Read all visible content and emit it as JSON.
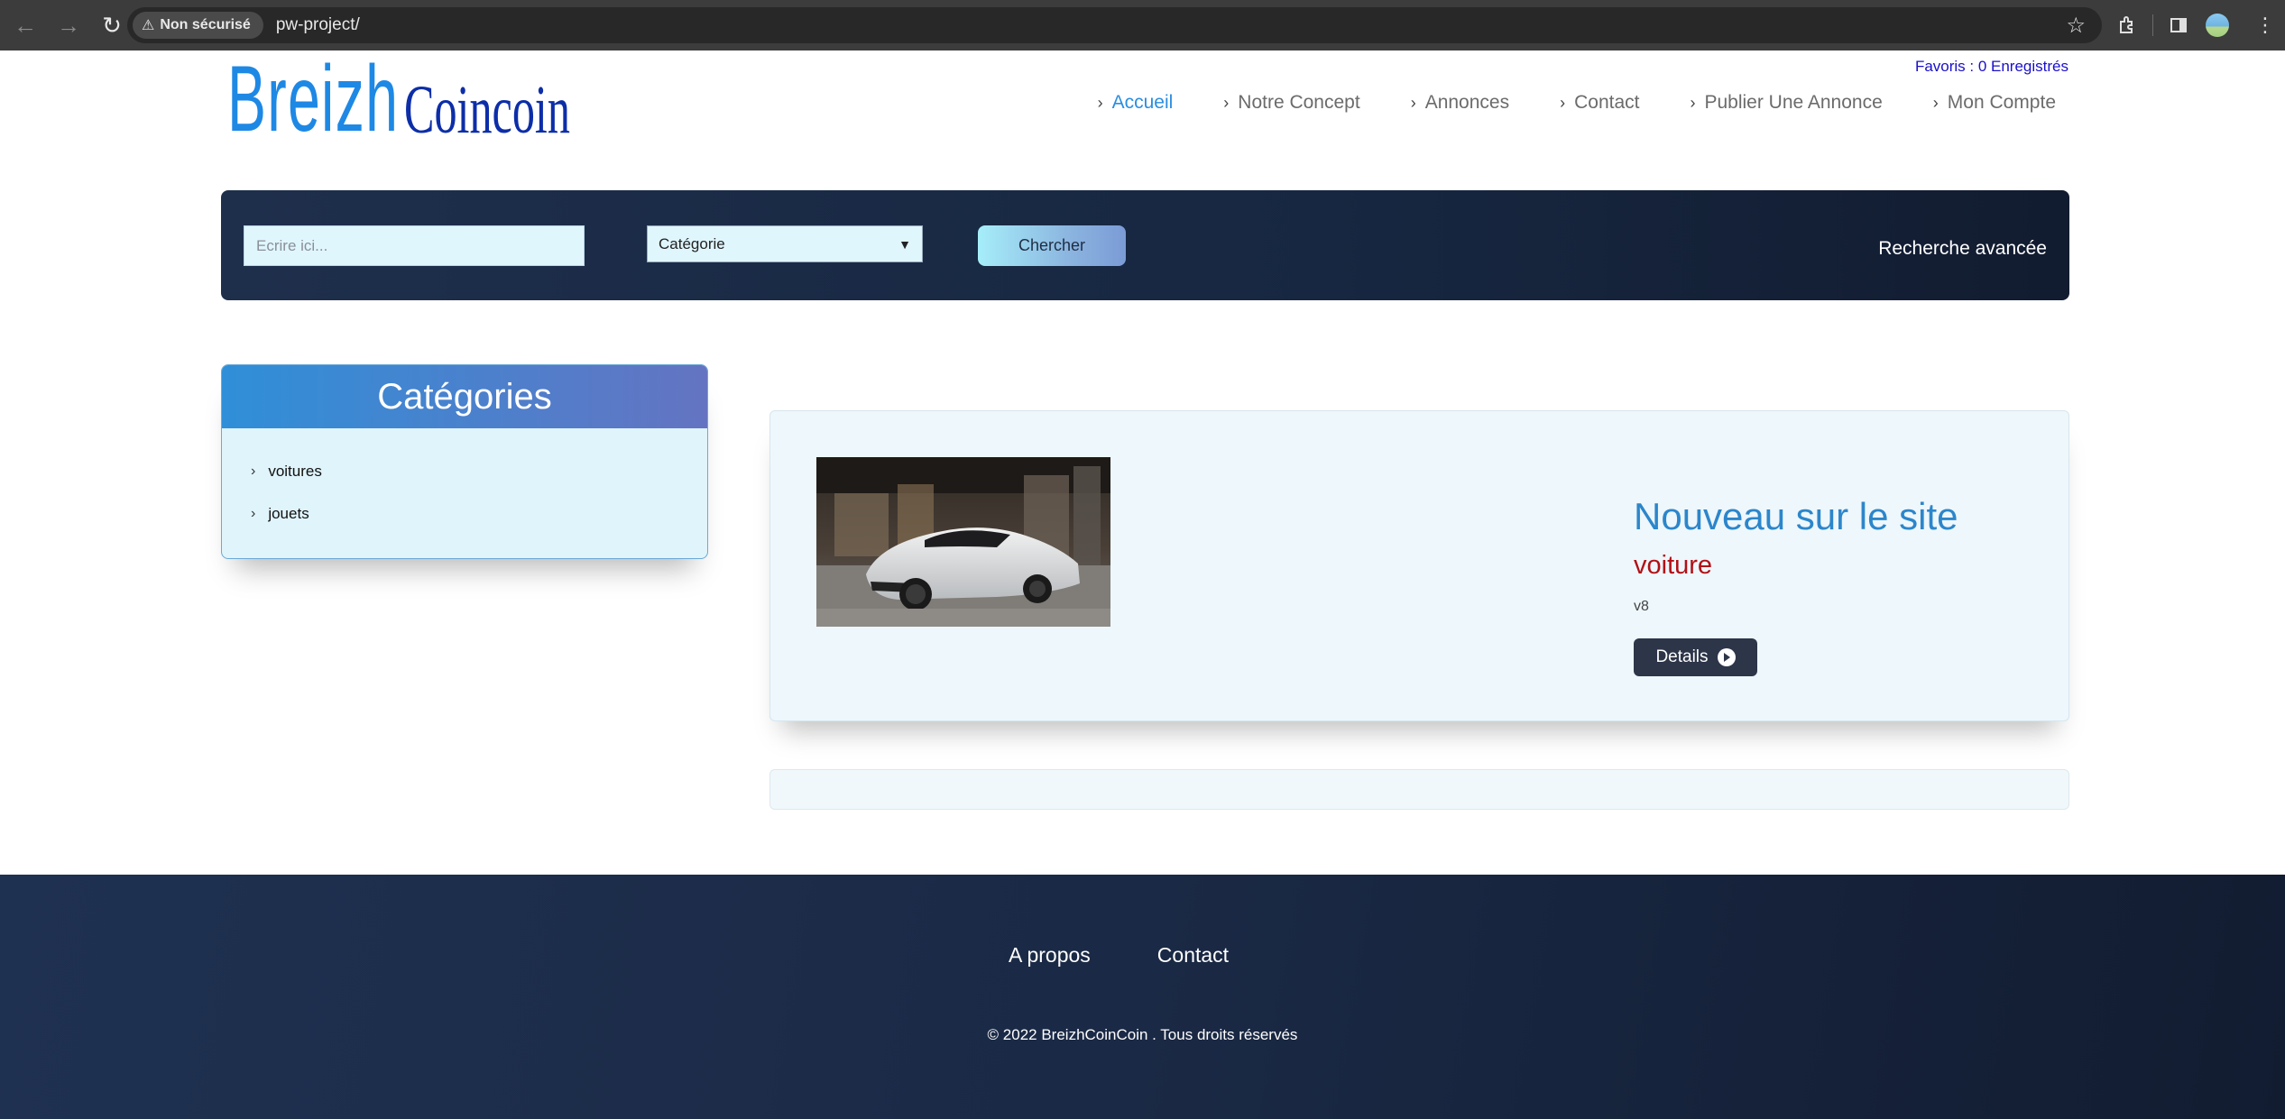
{
  "browser": {
    "security_label": "Non sécurisé",
    "url": "pw-project/"
  },
  "header": {
    "logo_part1": "Breizh",
    "logo_part2": "Coincoin",
    "favoris": "Favoris : 0 Enregistrés",
    "nav": [
      {
        "label": "Accueil"
      },
      {
        "label": "Notre Concept"
      },
      {
        "label": "Annonces"
      },
      {
        "label": "Contact"
      },
      {
        "label": "Publier Une Annonce"
      },
      {
        "label": "Mon Compte"
      }
    ]
  },
  "search": {
    "placeholder": "Ecrire ici...",
    "category_selected": "Catégorie",
    "button_label": "Chercher",
    "advanced_label": "Recherche avancée"
  },
  "sidebar": {
    "title": "Catégories",
    "items": [
      {
        "label": "voitures"
      },
      {
        "label": "jouets"
      }
    ]
  },
  "listing": {
    "heading": "Nouveau sur le site",
    "category": "voiture",
    "description": "v8",
    "details_label": "Details"
  },
  "footer": {
    "links": [
      {
        "label": "A propos"
      },
      {
        "label": "Contact"
      }
    ],
    "copyright": "© 2022 BreizhCoinCoin . Tous droits réservés"
  },
  "colors": {
    "accent_blue": "#2a8ee0",
    "listing_category_red": "#b21016",
    "dark_navy": "#1a2945"
  }
}
